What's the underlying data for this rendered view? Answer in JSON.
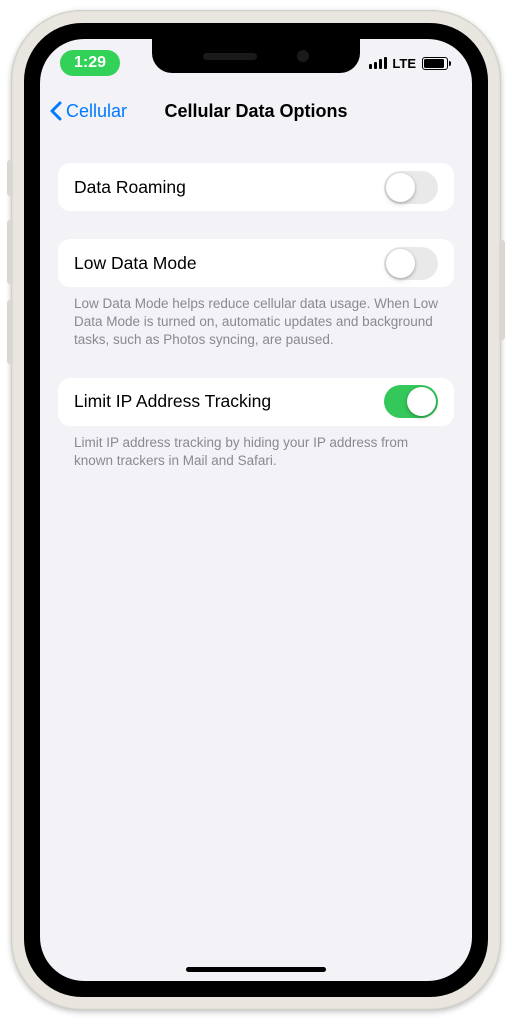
{
  "status_bar": {
    "time": "1:29",
    "network_label": "LTE"
  },
  "nav": {
    "back_label": "Cellular",
    "title": "Cellular Data Options"
  },
  "rows": {
    "data_roaming": {
      "label": "Data Roaming",
      "on": false
    },
    "low_data_mode": {
      "label": "Low Data Mode",
      "on": false
    },
    "low_data_mode_footer": "Low Data Mode helps reduce cellular data usage. When Low Data Mode is turned on, automatic updates and background tasks, such as Photos syncing, are paused.",
    "limit_ip": {
      "label": "Limit IP Address Tracking",
      "on": true
    },
    "limit_ip_footer": "Limit IP address tracking by hiding your IP address from known trackers in Mail and Safari."
  },
  "colors": {
    "accent_blue": "#007aff",
    "toggle_green": "#34c759",
    "bg": "#f2f2f7"
  }
}
